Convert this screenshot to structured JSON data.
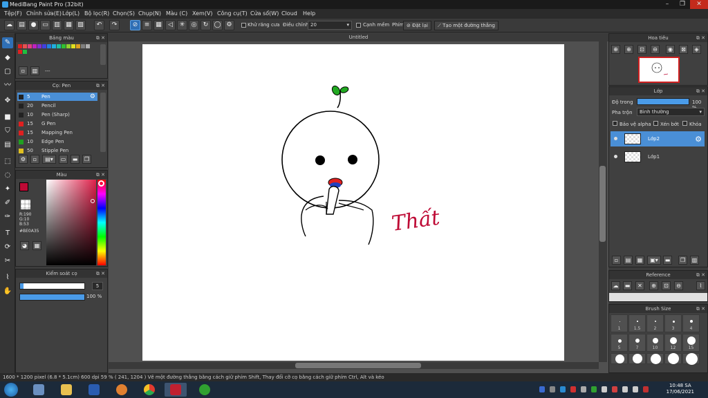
{
  "window": {
    "title": "MediBang Paint Pro (32bit)",
    "minimize": "–",
    "maximize": "❐",
    "close": "✕"
  },
  "menu": [
    "Tệp(F)",
    "Chỉnh sửa(E)",
    "Lớp(L)",
    "Bộ lọc(R)",
    "Chọn(S)",
    "Chụp(N)",
    "Màu (C)",
    "Xem(V)",
    "Công cụ(T)",
    "Cửa sổ(W)",
    "Cloud",
    "Help"
  ],
  "toolbar": {
    "antialias_label": "Khử răng cưa",
    "correction_label": "Điều chỉnh",
    "correction_value": "20",
    "soft_edge_label": "Cạnh mềm",
    "key_label": "Phím",
    "reset_label": "Đặt lại",
    "create_line_label": "Tạo một đường thẳng"
  },
  "palette": {
    "title": "Bảng màu",
    "placeholder": "---",
    "colors": [
      "#e02020",
      "#e85050",
      "#e04080",
      "#c020c0",
      "#8030d0",
      "#4040e0",
      "#2080e0",
      "#20b0e0",
      "#20c0a0",
      "#30c030",
      "#90d030",
      "#e0e020",
      "#e0a020",
      "#808080",
      "#b0b0b0",
      "#e02020",
      "#20c040"
    ]
  },
  "brushes": {
    "title": "Cọ: Pen",
    "items": [
      {
        "size": "5",
        "name": "Pen",
        "color": "#222222"
      },
      {
        "size": "20",
        "name": "Pencil",
        "color": "#222222"
      },
      {
        "size": "10",
        "name": "Pen (Sharp)",
        "color": "#222222"
      },
      {
        "size": "15",
        "name": "G Pen",
        "color": "#e02020"
      },
      {
        "size": "15",
        "name": "Mapping Pen",
        "color": "#e02020"
      },
      {
        "size": "10",
        "name": "Edge Pen",
        "color": "#20a020"
      },
      {
        "size": "50",
        "name": "Stipple Pen",
        "color": "#e0c020"
      }
    ]
  },
  "color": {
    "title": "Màu",
    "r": "R:190",
    "g": "G:10",
    "b": "B:53",
    "hex": "#BE0A35",
    "fg": "#be0a35"
  },
  "brush_control": {
    "title": "Kiểm soát cọ",
    "size": "5",
    "opacity": "100 %"
  },
  "document": {
    "tab": "Untitled",
    "text": "Thất"
  },
  "navigator": {
    "title": "Hoa tiêu"
  },
  "layer": {
    "title": "Lớp",
    "opacity_label": "Độ trong",
    "opacity_value": "100 %",
    "blend_label": "Pha trộn",
    "blend_value": "Bình thường",
    "protect_alpha": "Bảo vệ alpha",
    "clipping": "Xén bớt",
    "lock": "Khóa",
    "items": [
      "Lớp2",
      "Lớp1"
    ]
  },
  "reference": {
    "title": "Reference"
  },
  "brush_size": {
    "title": "Brush Size",
    "sizes": [
      "1",
      "1.5",
      "2",
      "3",
      "4",
      "5",
      "7",
      "10",
      "12",
      "15"
    ]
  },
  "status": {
    "text": "1600 * 1200 pixel  (6.8 * 5.1cm)  600 dpi  59 %  ( 241, 1204 )  Vẽ một đường thẳng bằng cách giữ phím Shift, Thay đổi cỡ cọ bằng cách giữ phím Ctrl, Alt và kéo"
  },
  "taskbar": {
    "time": "10:48 SA",
    "date": "17/06/2021"
  }
}
